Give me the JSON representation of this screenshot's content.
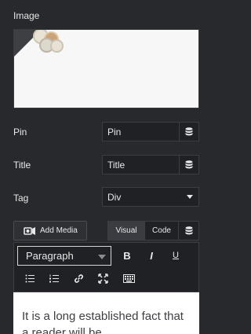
{
  "image_section": {
    "label": "Image"
  },
  "fields": {
    "pin": {
      "label": "Pin",
      "value": "Pin"
    },
    "title": {
      "label": "Title",
      "value": "Title"
    },
    "tag": {
      "label": "Tag",
      "value": "Div"
    }
  },
  "editor": {
    "add_media_label": "Add Media",
    "tabs": {
      "visual": "Visual",
      "code": "Code"
    },
    "format_value": "Paragraph",
    "toolbar_buttons": [
      "bold",
      "italic",
      "underline",
      "bullet-list",
      "numbered-list",
      "link",
      "fullscreen",
      "toolbar-toggle"
    ],
    "content_text": "It is a long established fact that a reader will be"
  },
  "colors": {
    "background": "#27292c",
    "field_bg": "#1f2124",
    "border": "#3c3e42"
  }
}
